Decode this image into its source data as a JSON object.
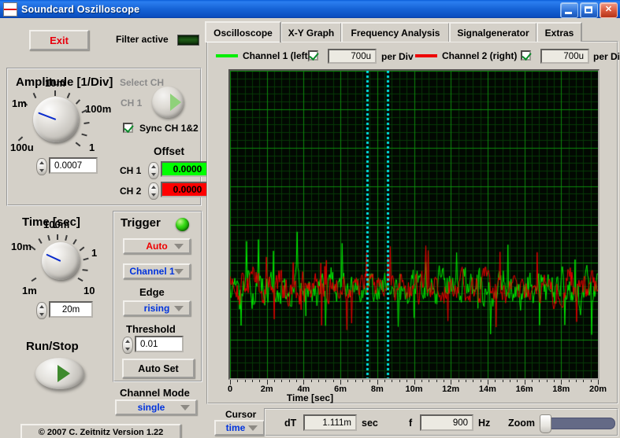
{
  "window": {
    "title": "Soundcard Oszilloscope",
    "icon": "scope-icon",
    "buttons": {
      "minimize": "minimize-icon",
      "maximize": "maximize-icon",
      "close": "close-icon"
    }
  },
  "toolbar": {
    "exit_label": "Exit",
    "filter_label": "Filter active",
    "filter_indicator": "led-indicator"
  },
  "amplitude": {
    "title": "Amplitude [1/Div]",
    "knob_labels": [
      "10m",
      "1m",
      "100m",
      "100u",
      "1"
    ],
    "value": "0.0007",
    "select_ch_label": "Select CH",
    "ch_label": "CH 1",
    "sync_label": "Sync CH 1&2",
    "sync_checked": true,
    "offset_title": "Offset",
    "offsets": [
      {
        "channel": "CH 1",
        "value": "0.0000",
        "color": "#00ff00"
      },
      {
        "channel": "CH 2",
        "value": "0.0000",
        "color": "#ff0000"
      }
    ]
  },
  "time": {
    "title": "Time [sec]",
    "knob_labels": [
      "100m",
      "10m",
      "1",
      "1m",
      "10"
    ],
    "value": "20m"
  },
  "trigger": {
    "title": "Trigger",
    "led": "trigger-led",
    "mode": "Auto",
    "mode_color": "#ee0000",
    "source": "Channel 1",
    "source_color": "#0033dd",
    "edge_label": "Edge",
    "edge": "rising",
    "edge_color": "#0033dd",
    "threshold_label": "Threshold",
    "threshold": "0.01",
    "autoset_label": "Auto Set"
  },
  "run": {
    "title": "Run/Stop",
    "button": "run-button"
  },
  "channel_mode": {
    "title": "Channel Mode",
    "value": "single",
    "value_color": "#0033dd"
  },
  "footer": {
    "copyright": "© 2007   C. Zeitnitz Version 1.22"
  },
  "tabs": [
    {
      "label": "Oscilloscope",
      "active": true
    },
    {
      "label": "X-Y Graph",
      "active": false
    },
    {
      "label": "Frequency Analysis",
      "active": false
    },
    {
      "label": "Signalgenerator",
      "active": false
    },
    {
      "label": "Extras",
      "active": false
    }
  ],
  "channels": [
    {
      "label": "Channel 1 (left)",
      "color": "#00ee00",
      "enabled": true,
      "scale": "700u",
      "unit": "per Div"
    },
    {
      "label": "Channel 2 (right)",
      "color": "#ee0000",
      "enabled": true,
      "scale": "700u",
      "unit": "per Div"
    }
  ],
  "cursor": {
    "title": "Cursor",
    "mode": "time",
    "mode_color": "#0033dd",
    "dt_label": "dT",
    "dt_value": "1.111m",
    "dt_unit": "sec",
    "f_label": "f",
    "f_value": "900",
    "f_unit": "Hz",
    "zoom_label": "Zoom",
    "zoom_value": 0
  },
  "chart_data": {
    "type": "line",
    "title": "",
    "xlabel": "Time [sec]",
    "ylabel": "",
    "xlim": [
      0,
      0.02
    ],
    "ylim": [
      -0.0028,
      0.0028
    ],
    "grid": true,
    "background": "#020802",
    "grid_color": "#0c8a0c",
    "minor_grid_color": "#073a07",
    "x_ticks": [
      "0",
      "2m",
      "4m",
      "6m",
      "8m",
      "10m",
      "12m",
      "14m",
      "16m",
      "18m",
      "20m"
    ],
    "x_tick_values": [
      0,
      0.002,
      0.004,
      0.006,
      0.008,
      0.01,
      0.012,
      0.014,
      0.016,
      0.018,
      0.02
    ],
    "divisions_x": 10,
    "divisions_y": 8,
    "cursors": {
      "color": "#00e5e5",
      "x_values": [
        0.00745,
        0.00856
      ],
      "style": "dotted"
    },
    "series": [
      {
        "name": "Channel 1 (left)",
        "color": "#00ee00",
        "type": "noise",
        "baseline": -0.00115,
        "amplitude": 0.00052,
        "seed": 1337,
        "points": 467
      },
      {
        "name": "Channel 2 (right)",
        "color": "#ee0000",
        "type": "noise",
        "baseline": -0.00115,
        "amplitude": 0.00046,
        "seed": 4242,
        "points": 467
      }
    ]
  }
}
